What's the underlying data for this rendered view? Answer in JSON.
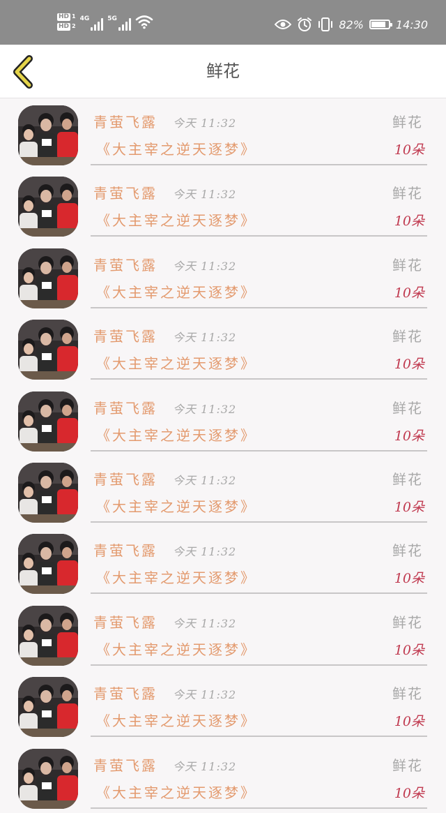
{
  "status_bar": {
    "hd1": "HD",
    "hd1_sub": "1",
    "hd2": "HD",
    "hd2_sub": "2",
    "network1": "4G",
    "network2": "5G",
    "battery_percent": "82%",
    "battery_level": 0.82,
    "time": "14:30",
    "icons": [
      "eye-icon",
      "alarm-icon",
      "vibrate-icon",
      "battery-icon",
      "wifi-icon",
      "signal-icon"
    ]
  },
  "header": {
    "title": "鲜花",
    "back_icon": "chevron-left-icon",
    "back_color": "#e5d44a"
  },
  "list": {
    "items": [
      {
        "sender": "青萤飞露",
        "time": "今天 11:32",
        "gift": "鲜花",
        "work": "《大主宰之逆天逐梦》",
        "count": "10朵"
      },
      {
        "sender": "青萤飞露",
        "time": "今天 11:32",
        "gift": "鲜花",
        "work": "《大主宰之逆天逐梦》",
        "count": "10朵"
      },
      {
        "sender": "青萤飞露",
        "time": "今天 11:32",
        "gift": "鲜花",
        "work": "《大主宰之逆天逐梦》",
        "count": "10朵"
      },
      {
        "sender": "青萤飞露",
        "time": "今天 11:32",
        "gift": "鲜花",
        "work": "《大主宰之逆天逐梦》",
        "count": "10朵"
      },
      {
        "sender": "青萤飞露",
        "time": "今天 11:32",
        "gift": "鲜花",
        "work": "《大主宰之逆天逐梦》",
        "count": "10朵"
      },
      {
        "sender": "青萤飞露",
        "time": "今天 11:32",
        "gift": "鲜花",
        "work": "《大主宰之逆天逐梦》",
        "count": "10朵"
      },
      {
        "sender": "青萤飞露",
        "time": "今天 11:32",
        "gift": "鲜花",
        "work": "《大主宰之逆天逐梦》",
        "count": "10朵"
      },
      {
        "sender": "青萤飞露",
        "time": "今天 11:32",
        "gift": "鲜花",
        "work": "《大主宰之逆天逐梦》",
        "count": "10朵"
      },
      {
        "sender": "青萤飞露",
        "time": "今天 11:32",
        "gift": "鲜花",
        "work": "《大主宰之逆天逐梦》",
        "count": "10朵"
      },
      {
        "sender": "青萤飞露",
        "time": "今天 11:32",
        "gift": "鲜花",
        "work": "《大主宰之逆天逐梦》",
        "count": "10朵"
      }
    ]
  },
  "colors": {
    "sender": "#e39a6e",
    "count": "#c0394f",
    "muted": "#a8a8a8",
    "status_bar": "#8c8c8c"
  }
}
